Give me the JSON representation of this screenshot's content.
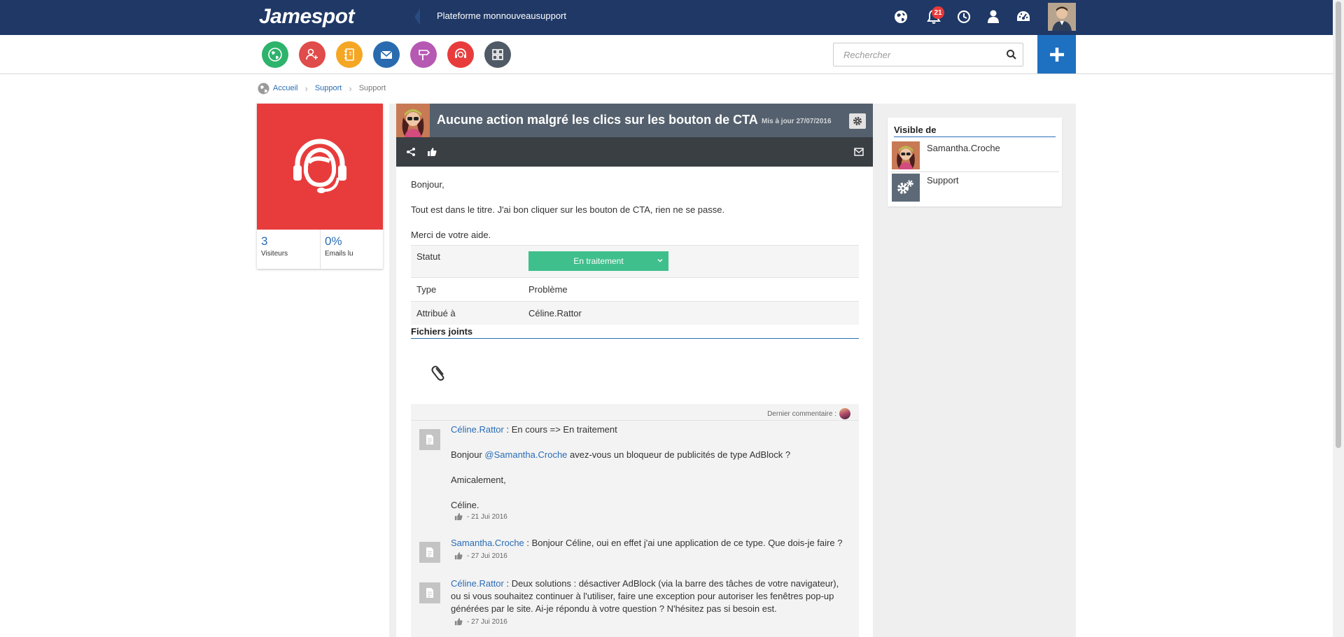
{
  "header": {
    "logo": "Jamespot",
    "platform": "Plateforme monnouveausupport",
    "notification_count": "21",
    "icons": [
      "globe-icon",
      "bell-icon",
      "clock-icon",
      "user-icon",
      "dashboard-icon"
    ]
  },
  "apps": [
    {
      "name": "globe",
      "color": "#2db36b"
    },
    {
      "name": "user-add",
      "color": "#e04b4b"
    },
    {
      "name": "notebook",
      "color": "#f5a623"
    },
    {
      "name": "mail",
      "color": "#2a6bb0"
    },
    {
      "name": "signpost",
      "color": "#b659b3"
    },
    {
      "name": "support",
      "color": "#e83c3c"
    },
    {
      "name": "grid",
      "color": "#505a66"
    }
  ],
  "search": {
    "placeholder": "Rechercher"
  },
  "breadcrumb": {
    "home": "Accueil",
    "section": "Support",
    "current": "Support"
  },
  "left_card": {
    "stats": [
      {
        "value": "3",
        "label": "Visiteurs"
      },
      {
        "value": "0%",
        "label": "Emails lu"
      }
    ]
  },
  "post": {
    "title": "Aucune action malgré les clics sur les bouton de CTA",
    "updated": "Mis à jour 27/07/2016",
    "body": [
      "Bonjour,",
      "Tout est dans le titre. J'ai bon cliquer sur les bouton de CTA, rien ne se passe.",
      "Merci de votre aide."
    ],
    "fields": {
      "status_label": "Statut",
      "status_value": "En traitement",
      "type_label": "Type",
      "type_value": "Problème",
      "assigned_label": "Attribué à",
      "assigned_value": "Céline.Rattor"
    },
    "attachments_title": "Fichiers joints"
  },
  "comments": {
    "last_label": "Dernier commentaire :",
    "items": [
      {
        "author": "Céline.Rattor",
        "first_line": " : En cours => En traitement",
        "greeting": "Bonjour ",
        "mention": "@Samantha.Croche",
        "question": " avez-vous un bloqueur de publicités de type AdBlock ?",
        "closing": "Amicalement,",
        "signature": "Céline.",
        "date": "- 21 Jui 2016"
      },
      {
        "author": "Samantha.Croche",
        "text": " : Bonjour Céline, oui en effet j'ai une application de ce type. Que dois-je faire ?",
        "date": "- 27 Jui 2016"
      },
      {
        "author": "Céline.Rattor",
        "text": " : Deux solutions : désactiver AdBlock (via la barre des tâches de votre navigateur), ou si vous souhaitez continuer à l'utiliser, faire une exception pour autoriser les fenêtres pop-up générées par le site. Ai-je répondu à votre question ? N'hésitez pas si besoin est.",
        "date": "- 27 Jui 2016"
      }
    ]
  },
  "visible": {
    "title": "Visible de",
    "items": [
      {
        "name": "Samantha.Croche"
      },
      {
        "name": "Support"
      }
    ]
  }
}
